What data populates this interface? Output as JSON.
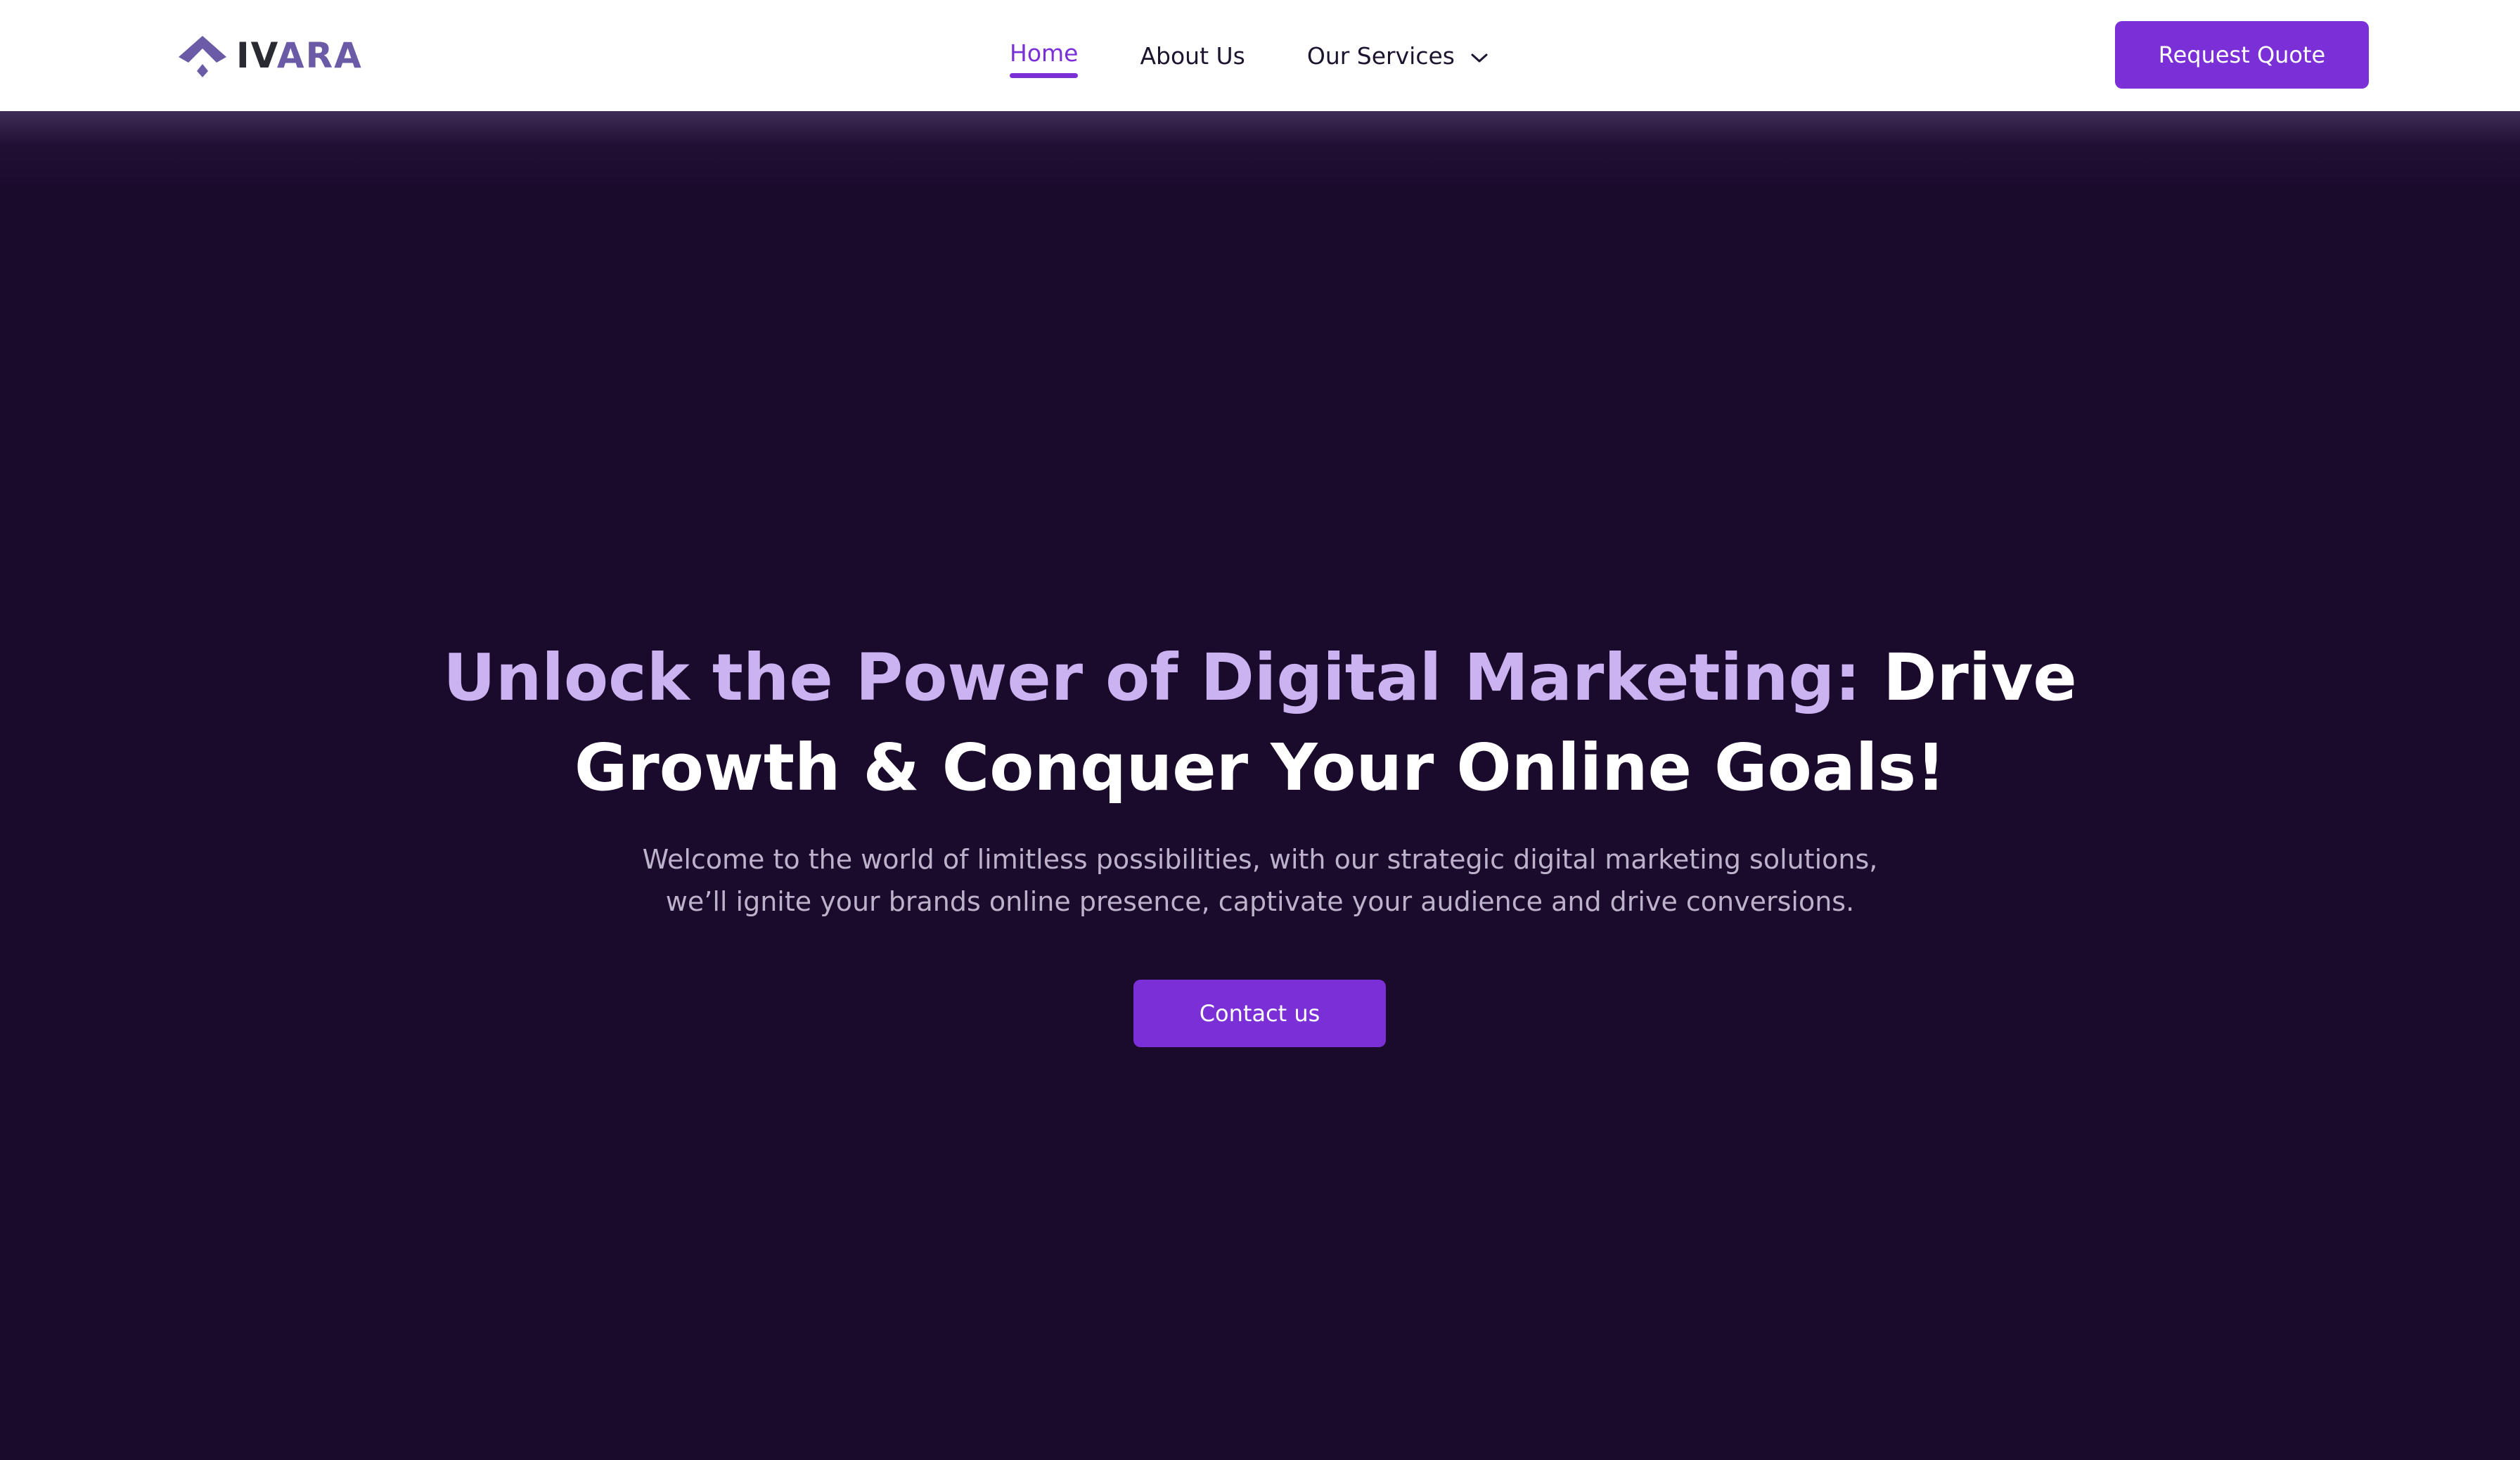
{
  "brand": {
    "logo_text_dark": "IV",
    "logo_text_accent": "ARA",
    "logo_icon": "ivara-logo-icon",
    "accent_color": "#6b5aa6"
  },
  "nav": {
    "items": [
      {
        "label": "Home",
        "active": true
      },
      {
        "label": "About Us",
        "active": false
      },
      {
        "label": "Our Services",
        "active": false,
        "icon": "chevron-down-icon"
      }
    ],
    "request_quote_label": "Request Quote"
  },
  "hero": {
    "title_highlight": "Unlock the Power of Digital Marketing:",
    "title_rest": "Drive Growth & Conquer Your Online Goals!",
    "subtitle_line1": "Welcome to the world of limitless possibilities, with our strategic digital marketing solutions,",
    "subtitle_line2": "we’ll ignite your brands online presence, captivate your audience and drive conversions.",
    "cta_label": "Contact us"
  },
  "colors": {
    "primary": "#7b2fd6",
    "hero_background": "#1a0a2c",
    "title_highlight": "#cbb3f2",
    "subtitle_text": "#bdb2cc",
    "header_background": "#ffffff"
  }
}
